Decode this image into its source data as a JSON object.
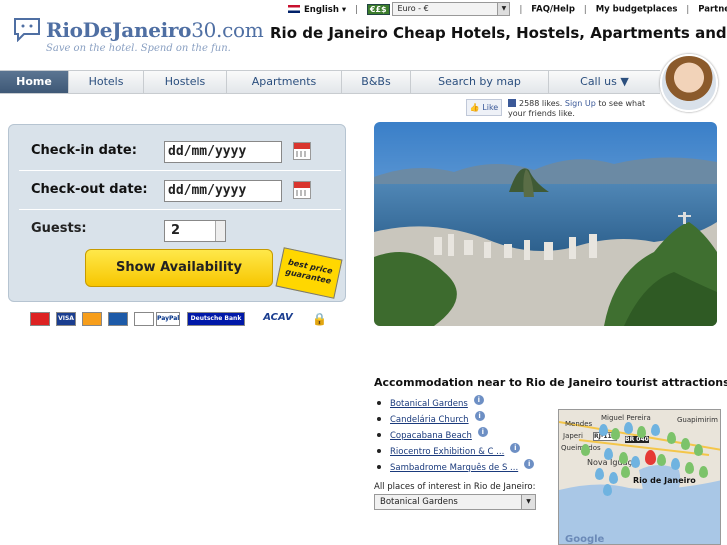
{
  "logo": {
    "brand": "RioDeJaneiro",
    "brand_suffix": "30.com",
    "tagline": "Save on the hotel. Spend on the fun."
  },
  "topbar": {
    "language": "English ▾",
    "currency_code": "€£$",
    "currency_value": "Euro - €",
    "links": [
      "FAQ/Help",
      "My budgetplaces",
      "Partner log in"
    ]
  },
  "headline": "Rio de Janeiro Cheap Hotels, Hostels, Apartments and B&Bs",
  "nav": {
    "items": [
      "Home",
      "Hotels",
      "Hostels",
      "Apartments",
      "B&Bs",
      "Search by map",
      "Call us ▼"
    ]
  },
  "like": {
    "button": "Like",
    "text_pre": "2588 likes.",
    "signup": "Sign Up",
    "text_post": "to see what your friends like."
  },
  "booking": {
    "checkin_label": "Check-in date:",
    "checkin_value": "dd/mm/yyyy",
    "checkout_label": "Check-out date:",
    "checkout_value": "dd/mm/yyyy",
    "guests_label": "Guests:",
    "guests_value": "2",
    "show_button": "Show Availability",
    "best_price": "best price guarantee"
  },
  "payment_cards": [
    "Maestro",
    "VISA",
    "MasterCard",
    "Maestro",
    "Aval",
    "PayPal",
    "Deutsche Bank",
    "ACAV",
    "🔒"
  ],
  "attractions": {
    "title": "Accommodation near to Rio de Janeiro tourist attractions",
    "items": [
      "Botanical Gardens",
      "Candelária Church",
      "Copacabana Beach",
      "Riocentro Exhibition & C ...",
      "Sambadrome Marquês de S ..."
    ],
    "all_places_label": "All places of interest in Rio de Janeiro:",
    "select_value": "Botanical Gardens"
  },
  "map": {
    "labels": [
      "Mendes",
      "Miguel Pereira",
      "Guapimirim",
      "Japeri",
      "RJ-113",
      "BR 040",
      "Queimados",
      "Nova Iguaçu",
      "Rio de Janeiro",
      "Google"
    ]
  },
  "colors": {
    "brand": "#4f6fa3",
    "nav_active": "#4a6583",
    "button_yellow": "#f7d11e",
    "panel_bg": "#d9e2ea"
  }
}
